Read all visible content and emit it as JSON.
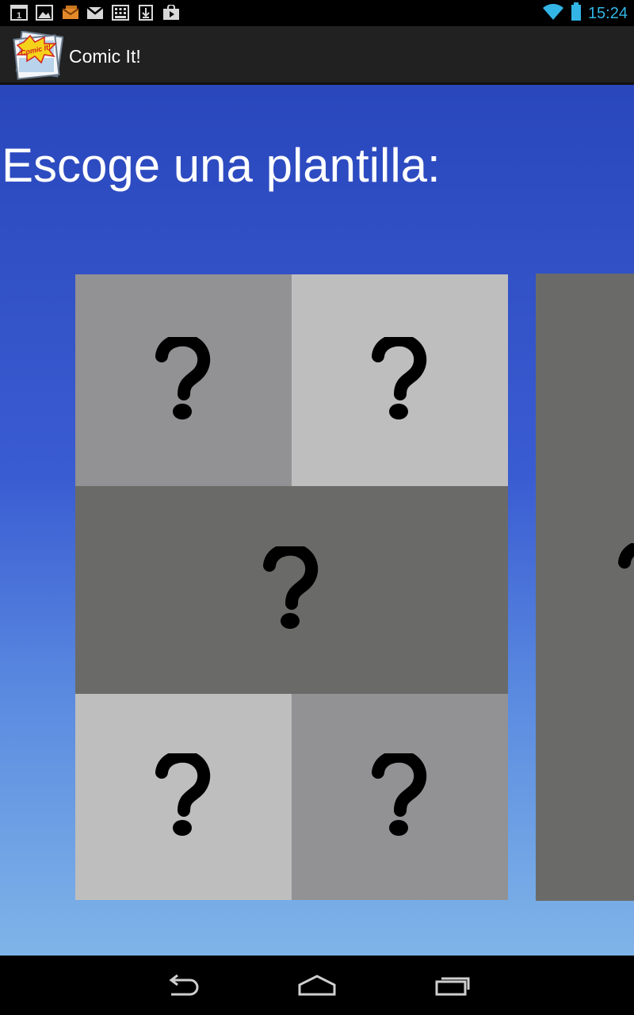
{
  "status_bar": {
    "time": "15:24",
    "notification_icons": [
      "calendar-icon",
      "gallery-icon",
      "email-icon",
      "gmail-icon",
      "keep-icon",
      "download-icon",
      "play-store-icon"
    ],
    "wifi_icon": "wifi-icon",
    "battery_icon": "battery-icon",
    "calendar_day": "1"
  },
  "action_bar": {
    "title": "Comic It!",
    "logo_text": "Comic It!"
  },
  "main": {
    "heading": "Escoge una plantilla:",
    "templates": [
      {
        "name": "template-1",
        "panels": [
          {
            "symbol": "?",
            "color": "#929193"
          },
          {
            "symbol": "?",
            "color": "#bebebe"
          },
          {
            "symbol": "?",
            "color": "#6a6b68"
          },
          {
            "symbol": "?",
            "color": "#bebebe"
          },
          {
            "symbol": "?",
            "color": "#929193"
          }
        ]
      },
      {
        "name": "template-2",
        "panels": [
          {
            "symbol": "?",
            "color": "#6a6b69"
          }
        ]
      }
    ]
  },
  "nav_bar": {
    "buttons": [
      "back-icon",
      "home-icon",
      "recent-apps-icon"
    ]
  },
  "colors": {
    "status_text": "#33b5e5",
    "action_bar_bg": "#212121",
    "gradient_top": "#2a47bc",
    "gradient_bottom": "#7fb4e8"
  }
}
